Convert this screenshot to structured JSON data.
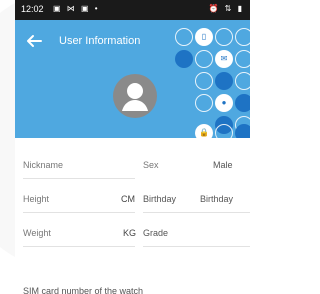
{
  "status_bar": {
    "time": "12:02",
    "left_icons": "▣ ⋈ ▣ •",
    "right_icons": "⏰ ⇅ ▮"
  },
  "header": {
    "title": "User Information"
  },
  "form": {
    "nickname_label": "Nickname",
    "sex_label": "Sex",
    "sex_value": "Male",
    "height_label": "Height",
    "height_unit": "CM",
    "birthday_label": "Birthday",
    "birthday_value": "Birthday",
    "weight_label": "Weight",
    "weight_unit": "KG",
    "grade_label": "Grade",
    "sim_label": "SIM card number of the watch"
  },
  "colors": {
    "header": "#4fa8e0",
    "accent_dark": "#1e73c4"
  }
}
